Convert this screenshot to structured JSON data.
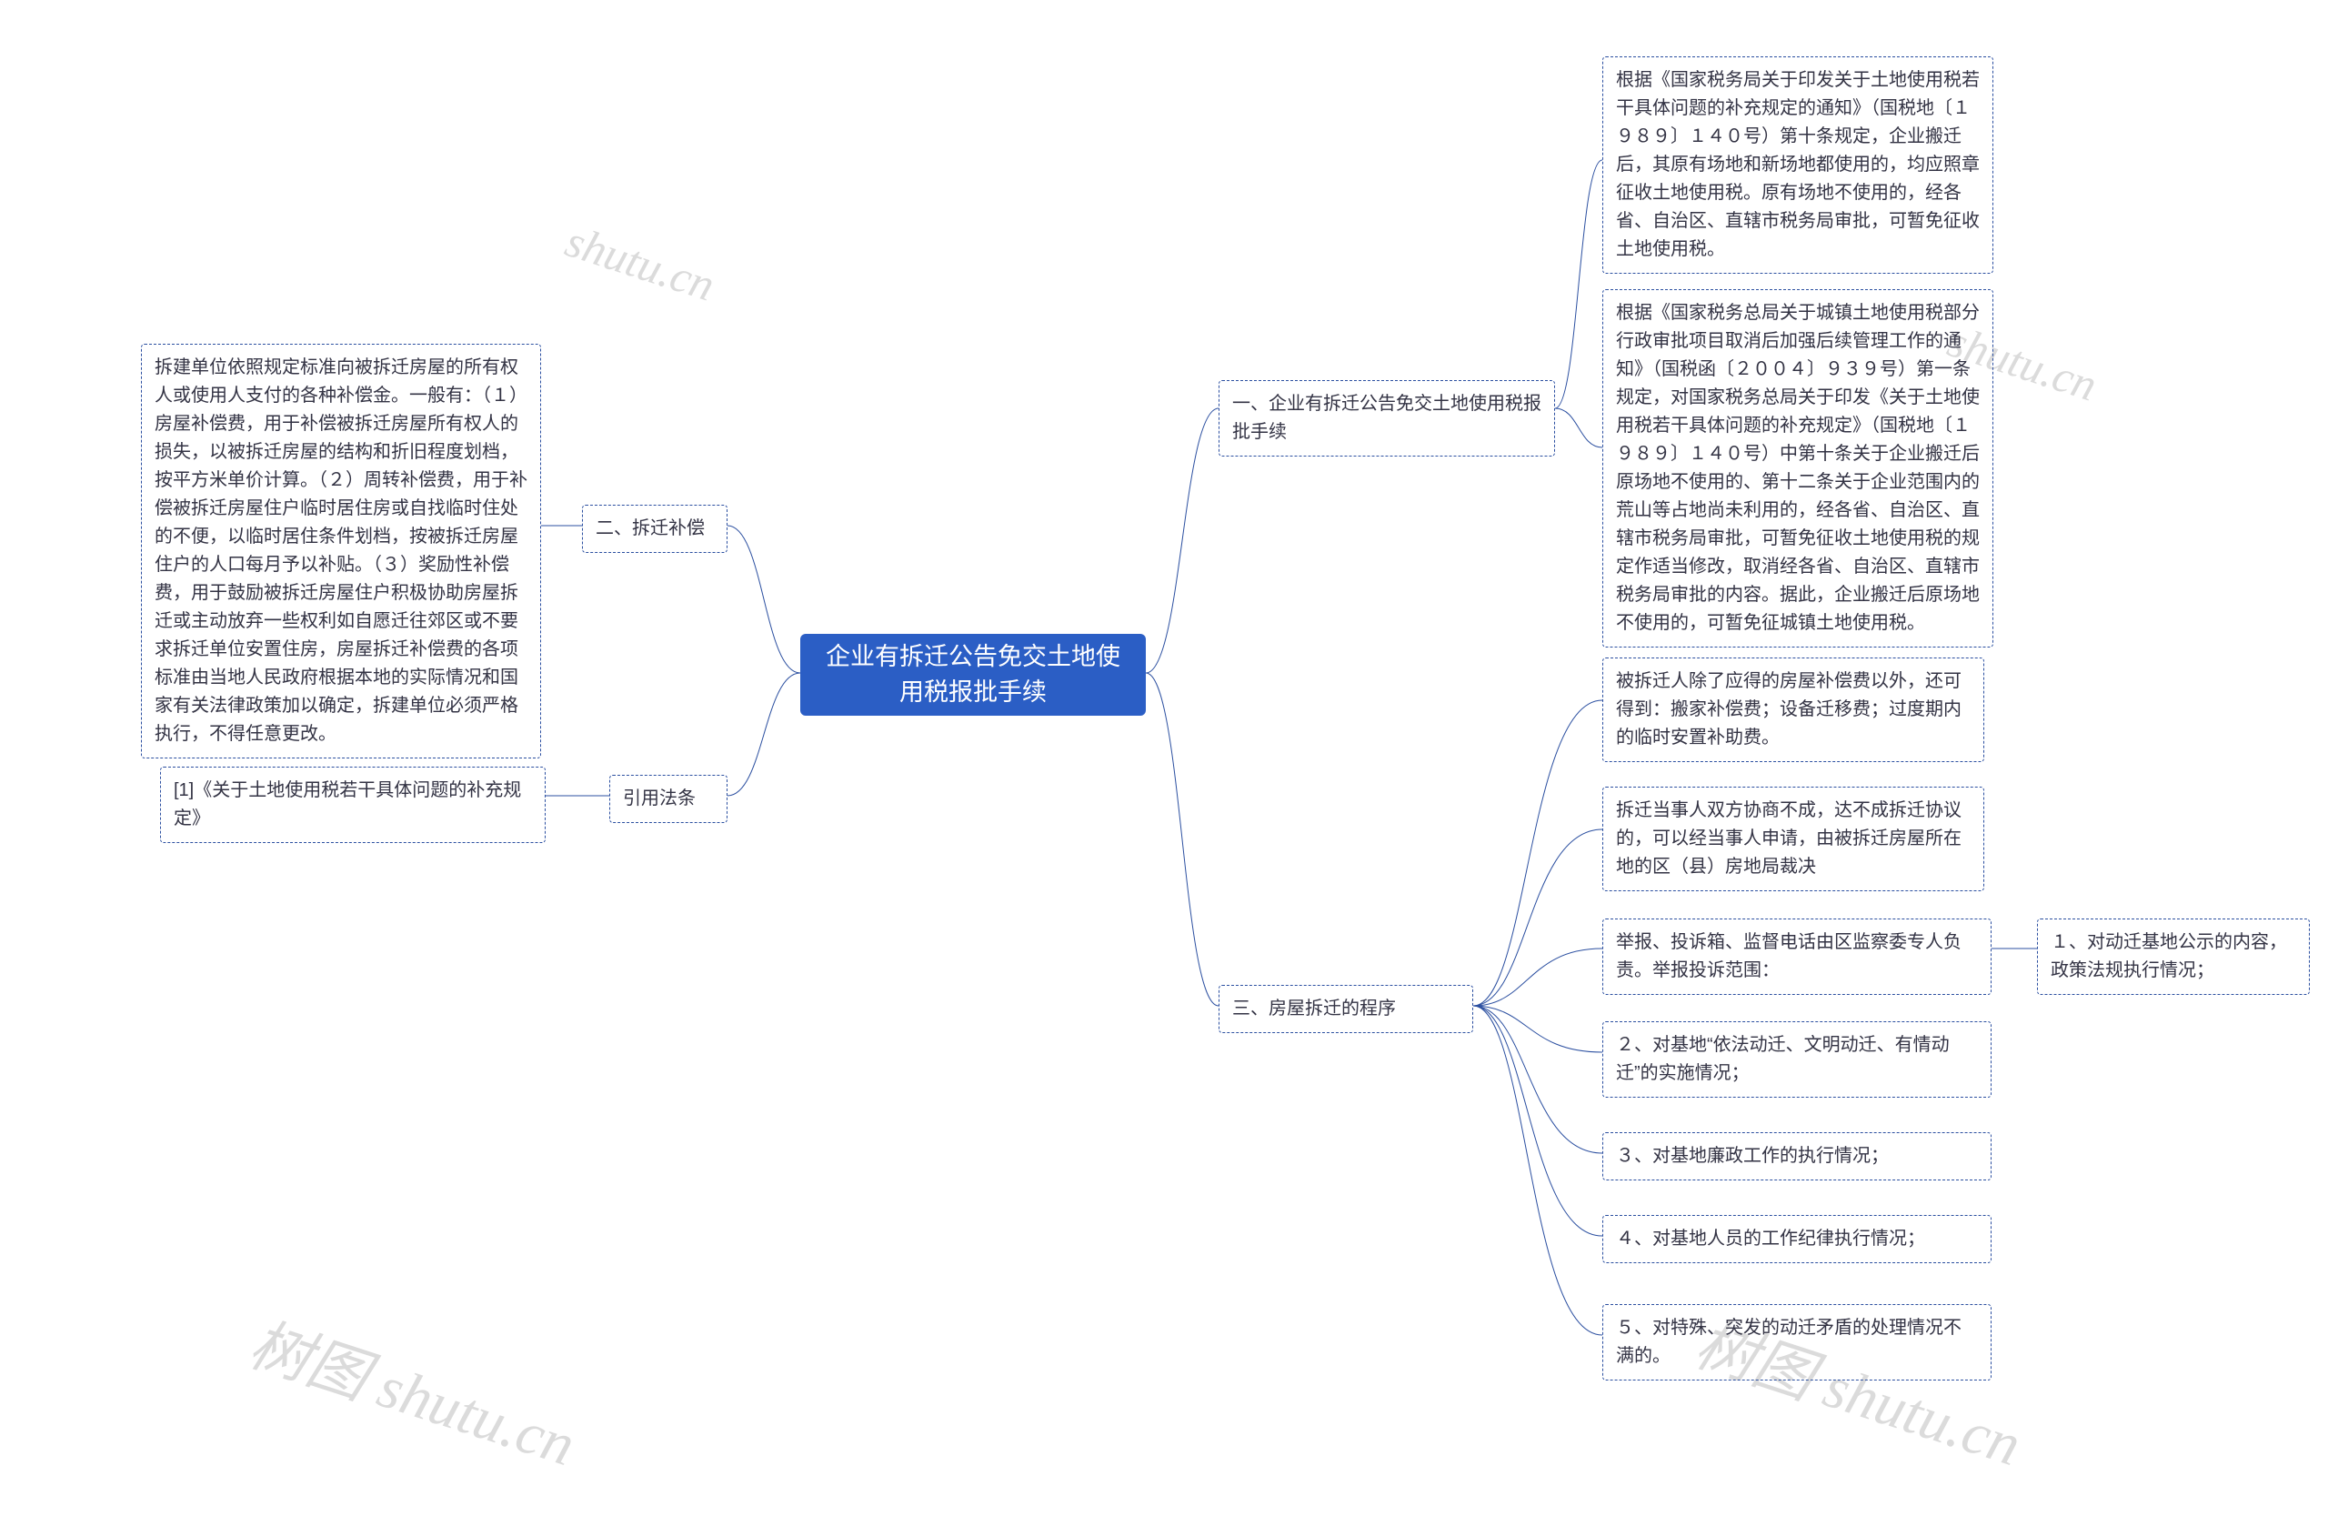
{
  "root": {
    "title": "企业有拆迁公告免交土地使用税报批手续"
  },
  "right": {
    "branch1": {
      "label": "一、企业有拆迁公告免交土地使用税报批手续",
      "child1": "根据《国家税务局关于印发关于土地使用税若干具体问题的补充规定的通知》（国税地〔１９８９〕１４０号）第十条规定，企业搬迁后，其原有场地和新场地都使用的，均应照章征收土地使用税。原有场地不使用的，经各省、自治区、直辖市税务局审批，可暂免征收土地使用税。",
      "child2": "根据《国家税务总局关于城镇土地使用税部分行政审批项目取消后加强后续管理工作的通知》（国税函〔２００４〕９３９号）第一条规定，对国家税务总局关于印发《关于土地使用税若干具体问题的补充规定》（国税地〔１９８９〕１４０号）中第十条关于企业搬迁后原场地不使用的、第十二条关于企业范围内的荒山等占地尚未利用的，经各省、自治区、直辖市税务局审批，可暂免征收土地使用税的规定作适当修改，取消经各省、自治区、直辖市税务局审批的内容。据此，企业搬迁后原场地不使用的，可暂免征城镇土地使用税。"
    },
    "branch3": {
      "label": "三、房屋拆迁的程序",
      "child1": "被拆迁人除了应得的房屋补偿费以外，还可得到：搬家补偿费；设备迁移费；过度期内的临时安置补助费。",
      "child2": "拆迁当事人双方协商不成，达不成拆迁协议的，可以经当事人申请，由被拆迁房屋所在地的区（县）房地局裁决",
      "child3": {
        "label": "举报、投诉箱、监督电话由区监察委专人负责。举报投诉范围：",
        "sub1": "１、对动迁基地公示的内容，政策法规执行情况；"
      },
      "child4": "２、对基地“依法动迁、文明动迁、有情动迁”的实施情况；",
      "child5": "３、对基地廉政工作的执行情况；",
      "child6": "４、对基地人员的工作纪律执行情况；",
      "child7": "５、对特殊、突发的动迁矛盾的处理情况不满的。"
    }
  },
  "left": {
    "branch2": {
      "label": "二、拆迁补偿",
      "child": "拆建单位依照规定标准向被拆迁房屋的所有权人或使用人支付的各种补偿金。一般有：（１）房屋补偿费，用于补偿被拆迁房屋所有权人的损失，以被拆迁房屋的结构和折旧程度划档，按平方米单价计算。（２）周转补偿费，用于补偿被拆迁房屋住户临时居住房或自找临时住处的不便，以临时居住条件划档，按被拆迁房屋住户的人口每月予以补贴。（３）奖励性补偿费，用于鼓励被拆迁房屋住户积极协助房屋拆迁或主动放弃一些权利如自愿迁往郊区或不要求拆迁单位安置住房，房屋拆迁补偿费的各项标准由当地人民政府根据本地的实际情况和国家有关法律政策加以确定，拆建单位必须严格执行，不得任意更改。"
    },
    "branchRef": {
      "label": "引用法条",
      "child": "[1]《关于土地使用税若干具体问题的补充规定》"
    }
  },
  "watermarks": {
    "text_full": "树图 shutu.cn",
    "text_short": "shutu.cn"
  }
}
